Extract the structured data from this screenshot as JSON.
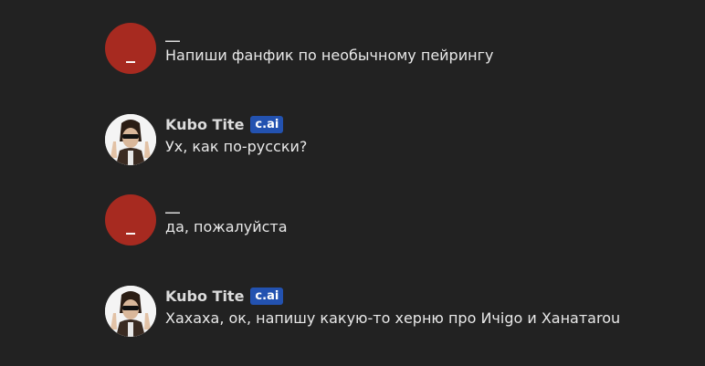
{
  "messages": [
    {
      "author": "__",
      "avatar_initial": "_",
      "text": "Напиши фанфик по необычному пейрингу"
    },
    {
      "author": "Kubo Tite",
      "badge": "c.ai",
      "text": "Ух, как по-русски?"
    },
    {
      "author": "__",
      "avatar_initial": "_",
      "text": "да, пожалуйста"
    },
    {
      "author": "Kubo Tite",
      "badge": "c.ai",
      "text": "Хахаха, ок, напишу какую-то херню про Ичigo и Ханатаrou"
    }
  ],
  "colors": {
    "background": "#222222",
    "user_avatar": "#a72a20",
    "badge": "#2352b0"
  }
}
